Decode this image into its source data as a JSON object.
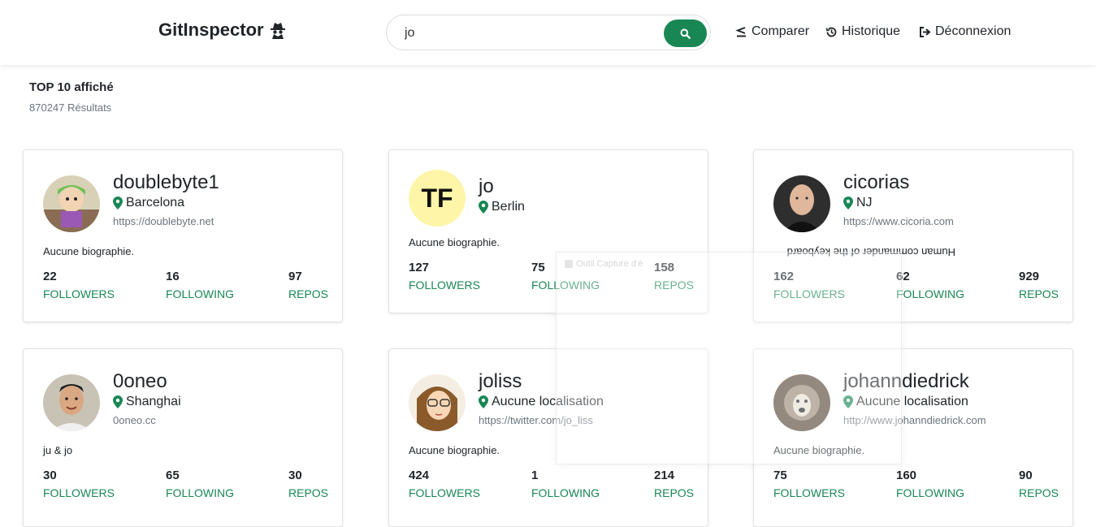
{
  "header": {
    "brand": "GitInspector",
    "search_value": "jo",
    "nav": {
      "compare": "Comparer",
      "history": "Historique",
      "logout": "Déconnexion"
    }
  },
  "summary": {
    "title": "TOP 10 affiché",
    "count": "870247 Résultats"
  },
  "users": [
    {
      "login": "doublebyte1",
      "location": "Barcelona",
      "blog": "https://doublebyte.net",
      "bio": "Aucune biographie.",
      "followers": "22",
      "following": "16",
      "repos": "97"
    },
    {
      "login": "jo",
      "location": "Berlin",
      "blog": "",
      "bio": "Aucune biographie.",
      "followers": "127",
      "following": "75",
      "repos": "158"
    },
    {
      "login": "cicorias",
      "location": "NJ",
      "blog": "https://www.cicoria.com",
      "bio": "Human commander of the keyboard",
      "followers": "162",
      "following": "62",
      "repos": "929"
    },
    {
      "login": "0oneo",
      "location": "Shanghai",
      "blog": "0oneo.cc",
      "bio": "ju & jo",
      "followers": "30",
      "following": "65",
      "repos": "30"
    },
    {
      "login": "joliss",
      "location": "Aucune localisation",
      "blog": "https://twitter.com/jo_liss",
      "bio": "Aucune biographie.",
      "followers": "424",
      "following": "1",
      "repos": "214"
    },
    {
      "login": "johanndiedrick",
      "location": "Aucune localisation",
      "blog": "http://www.johanndiedrick.com",
      "bio": "Aucune biographie.",
      "followers": "75",
      "following": "160",
      "repos": "90"
    }
  ],
  "stat_labels": {
    "followers": "FOLLOWERS",
    "following": "FOLLOWING",
    "repos": "REPOS"
  },
  "overlay": {
    "title": "Outil Capture d'é"
  },
  "colors": {
    "accent": "#198754",
    "muted": "#6c757d",
    "text": "#212529"
  }
}
